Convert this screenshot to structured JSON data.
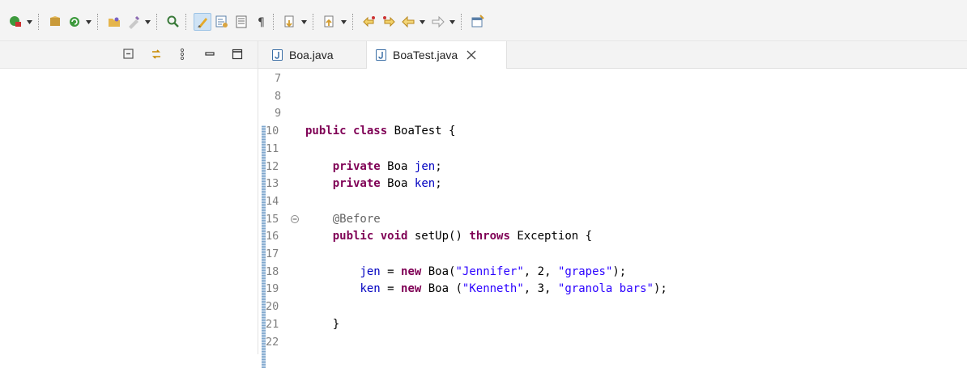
{
  "toolbar": {
    "items": [
      {
        "icon": "run-config-icon",
        "dropdown": true
      },
      {
        "icon": "package-icon",
        "dropdown": false
      },
      {
        "icon": "refresh-icon",
        "dropdown": true
      },
      {
        "icon": "open-folder-icon",
        "dropdown": false
      },
      {
        "icon": "external-tools-icon",
        "dropdown": true
      },
      {
        "icon": "search-icon",
        "dropdown": false
      },
      {
        "icon": "highlight-icon",
        "dropdown": false,
        "active": true
      },
      {
        "icon": "block-selection-icon",
        "dropdown": false
      },
      {
        "icon": "show-source-icon",
        "dropdown": false
      },
      {
        "icon": "pilcrow-icon",
        "dropdown": false
      },
      {
        "icon": "next-annotation-icon",
        "dropdown": true
      },
      {
        "icon": "prev-annotation-icon",
        "dropdown": true
      },
      {
        "icon": "last-edit-icon",
        "dropdown": false
      },
      {
        "icon": "next-edit-icon",
        "dropdown": false
      },
      {
        "icon": "back-icon",
        "dropdown": true
      },
      {
        "icon": "forward-icon",
        "dropdown": true
      },
      {
        "icon": "pin-editor-icon",
        "dropdown": false
      }
    ],
    "pilcrow": "¶"
  },
  "left_panel": {
    "icons": [
      "collapse-all-icon",
      "link-with-editor-icon",
      "view-menu-icon",
      "minimize-icon",
      "maximize-icon"
    ]
  },
  "editor": {
    "tabs": [
      {
        "label": "Boa.java",
        "active": false
      },
      {
        "label": "BoaTest.java",
        "active": true
      }
    ],
    "lines": [
      {
        "num": "7",
        "tokens": []
      },
      {
        "num": "8",
        "tokens": []
      },
      {
        "num": "9",
        "tokens": []
      },
      {
        "num": "10",
        "tokens": [
          {
            "t": "public",
            "c": "kw"
          },
          {
            "t": " "
          },
          {
            "t": "class",
            "c": "kw"
          },
          {
            "t": " BoaTest {"
          }
        ]
      },
      {
        "num": "11",
        "tokens": []
      },
      {
        "num": "12",
        "tokens": [
          {
            "t": "    "
          },
          {
            "t": "private",
            "c": "kw"
          },
          {
            "t": " Boa "
          },
          {
            "t": "jen",
            "c": "fld"
          },
          {
            "t": ";"
          }
        ]
      },
      {
        "num": "13",
        "tokens": [
          {
            "t": "    "
          },
          {
            "t": "private",
            "c": "kw"
          },
          {
            "t": " Boa "
          },
          {
            "t": "ken",
            "c": "fld"
          },
          {
            "t": ";"
          }
        ]
      },
      {
        "num": "14",
        "tokens": []
      },
      {
        "num": "15",
        "fold": true,
        "tokens": [
          {
            "t": "    "
          },
          {
            "t": "@Before",
            "c": "ann"
          }
        ]
      },
      {
        "num": "16",
        "tokens": [
          {
            "t": "    "
          },
          {
            "t": "public",
            "c": "kw"
          },
          {
            "t": " "
          },
          {
            "t": "void",
            "c": "kw"
          },
          {
            "t": " setUp() "
          },
          {
            "t": "throws",
            "c": "kw"
          },
          {
            "t": " Exception {"
          }
        ]
      },
      {
        "num": "17",
        "tokens": []
      },
      {
        "num": "18",
        "tokens": [
          {
            "t": "        "
          },
          {
            "t": "jen",
            "c": "fld"
          },
          {
            "t": " = "
          },
          {
            "t": "new",
            "c": "kw"
          },
          {
            "t": " Boa("
          },
          {
            "t": "\"Jennifer\"",
            "c": "str"
          },
          {
            "t": ", 2, "
          },
          {
            "t": "\"grapes\"",
            "c": "str"
          },
          {
            "t": ");"
          }
        ]
      },
      {
        "num": "19",
        "tokens": [
          {
            "t": "        "
          },
          {
            "t": "ken",
            "c": "fld"
          },
          {
            "t": " = "
          },
          {
            "t": "new",
            "c": "kw"
          },
          {
            "t": " Boa ("
          },
          {
            "t": "\"Kenneth\"",
            "c": "str"
          },
          {
            "t": ", 3, "
          },
          {
            "t": "\"granola bars\"",
            "c": "str"
          },
          {
            "t": ");"
          }
        ]
      },
      {
        "num": "20",
        "tokens": []
      },
      {
        "num": "21",
        "tokens": [
          {
            "t": "    }"
          }
        ]
      },
      {
        "num": "22",
        "tokens": []
      }
    ]
  },
  "colors": {
    "keyword": "#7f0055",
    "field": "#0000c0",
    "string": "#2a00ff",
    "annotation": "#646464",
    "line_number": "#7f7f7f"
  }
}
